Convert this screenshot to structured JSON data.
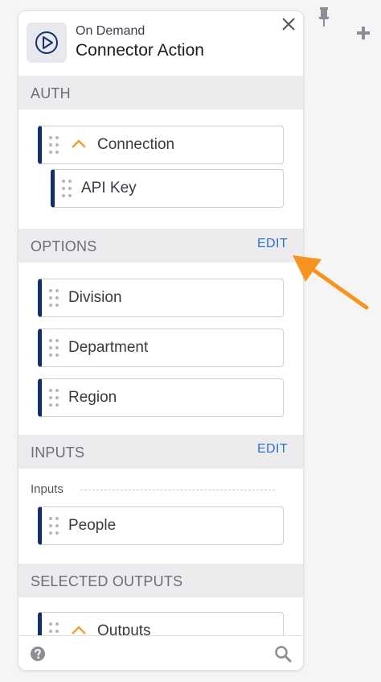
{
  "header": {
    "subtitle": "On Demand",
    "title": "Connector Action"
  },
  "sections": {
    "auth": {
      "label": "AUTH"
    },
    "options": {
      "label": "OPTIONS",
      "edit_label": "EDIT"
    },
    "inputs": {
      "label": "INPUTS",
      "edit_label": "EDIT",
      "group_label": "Inputs"
    },
    "outputs": {
      "label": "SELECTED OUTPUTS"
    }
  },
  "fields": {
    "connection": "Connection",
    "api_key": "API Key",
    "division": "Division",
    "department": "Department",
    "region": "Region",
    "people": "People",
    "outputs": "Outputs"
  },
  "icons": {
    "app": "play-circle-icon",
    "close": "close-icon",
    "pin": "pin-icon",
    "plus": "plus-icon",
    "help": "help-icon",
    "search": "search-icon",
    "collapse": "chevron-up-icon",
    "drag": "drag-handle-icon"
  },
  "colors": {
    "accent_bar": "#14306b",
    "link": "#2f6fcf",
    "chevron": "#f0a030",
    "annotation_arrow": "#f7931e",
    "section_bg": "#ececee"
  }
}
